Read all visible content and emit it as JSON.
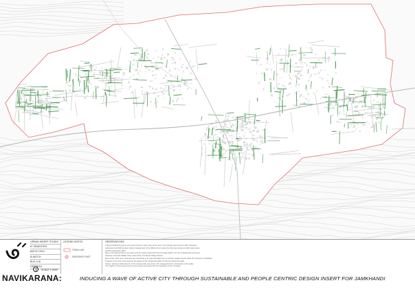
{
  "sheet": {
    "colors": {
      "boundary": "#e06a6a",
      "active_street": "#4e9a57",
      "roads": "#c9c9c9",
      "contours": "#cfcfcf",
      "buildings": "#bdbdbd"
    }
  },
  "title_block": {
    "studio": "URBAN INSERT STUDIO",
    "semester": "IX SEMESTER",
    "batch": "BATCH 2014",
    "batch_label": "B-BATCH",
    "sheet_no": "BUS-II-ID",
    "name": "DEEBEAU",
    "scale": "SCALE 1:4000",
    "legend_title": "LEGEND-SOFOS",
    "legend_items": [
      {
        "label": "TOWN LINE",
        "color": "#e06a6a"
      },
      {
        "label": "OBSERVED PART",
        "color": "#e06a6a"
      }
    ],
    "observations_title": "OBSERVATIONS",
    "observations": [
      "In Mysore Brand & grapes more ground level on open area can be seen. The existing open area are with moderately",
      "maintained and fulfill demand. Active management of the different from towns from the open areas on which water tanks",
      "and the cooperative stairs.",
      "Most of the allowed that in city center and the market areas which the city walk leaders from the underground cross lines.",
      "However, areas like Middle Chira, Kadur Park, and Mumbi Marga Streets.",
      "Most of the urban open areas also are connecting to its road with Ways from a network of water streets within the extension of buildings.",
      "Transport in the form of the lines for the spaces of the Jamkhandi which to it the bus along the roads.",
      "Streets, wherever which also for, in the volumes that ones lanes. The storage flow from connections in the walks.",
      "The majority of town areas such as courts along the streets with the pedestrian of the municipal."
    ],
    "main_title": "NAVIKARANA:",
    "subtitle": "INDUCING A WAVE OF ACTIVE CITY THROUGH SUSTAINABLE AND PEOPLE CENTRIC DESIGN INSERT FOR JAMKHANDI"
  }
}
